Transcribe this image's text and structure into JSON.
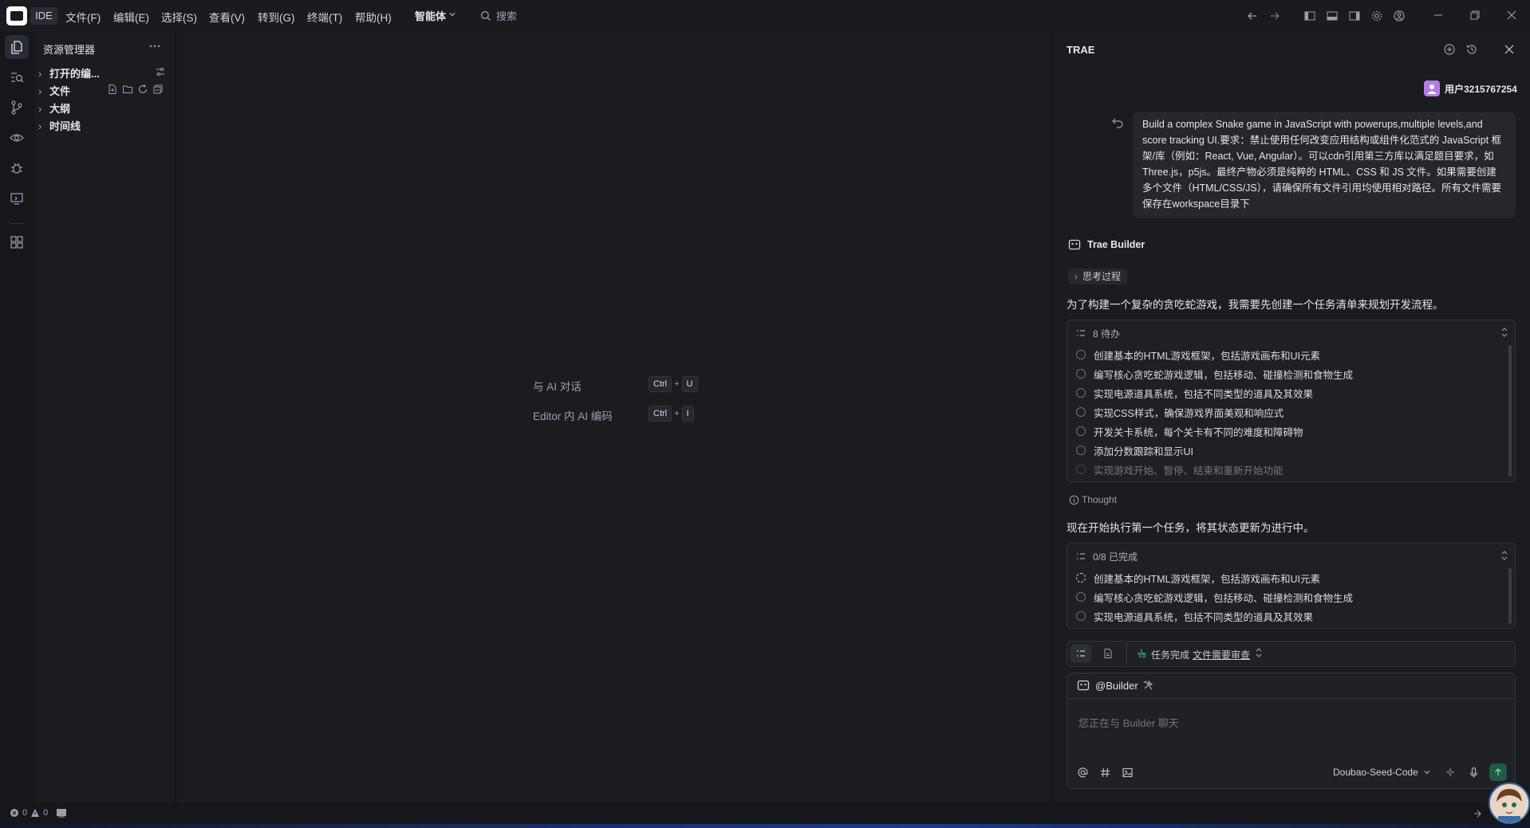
{
  "titlebar": {
    "ide_tag": "IDE",
    "menu": [
      "文件(F)",
      "编辑(E)",
      "选择(S)",
      "查看(V)",
      "转到(G)",
      "终端(T)",
      "帮助(H)"
    ],
    "mode": "智能体",
    "search_placeholder": "搜索"
  },
  "explorer": {
    "title": "资源管理器",
    "sections": [
      "打开的编...",
      "文件",
      "大纲",
      "时间线"
    ]
  },
  "editor": {
    "hints": [
      {
        "label": "与 AI 对话",
        "keys": [
          "Ctrl",
          "U"
        ]
      },
      {
        "label": "Editor 内 AI 编码",
        "keys": [
          "Ctrl",
          "I"
        ]
      }
    ],
    "plus": "+"
  },
  "chat": {
    "title": "TRAE",
    "user_name": "用户3215767254",
    "user_message": "Build a complex Snake game in JavaScript with powerups,multiple levels,and score tracking UI.要求：禁止使用任何改变应用结构或组件化范式的 JavaScript 框架/库（例如：React, Vue, Angular）。可以cdn引用第三方库以满足题目要求，如Three.js，p5js。最终产物必须是纯粹的 HTML、CSS 和 JS 文件。如果需要创建多个文件（HTML/CSS/JS），请确保所有文件引用均使用相对路径。所有文件需要保存在workspace目录下",
    "builder_name": "Trae Builder",
    "think_chip": "思考过程",
    "para1": "为了构建一个复杂的贪吃蛇游戏，我需要先创建一个任务清单来规划开发流程。",
    "todo_header": "8 待办",
    "todo_items": [
      "创建基本的HTML游戏框架，包括游戏画布和UI元素",
      "编写核心贪吃蛇游戏逻辑，包括移动、碰撞检测和食物生成",
      "实现电源道具系统，包括不同类型的道具及其效果",
      "实现CSS样式，确保游戏界面美观和响应式",
      "开发关卡系统，每个关卡有不同的难度和障碍物",
      "添加分数跟踪和显示UI",
      "实现游戏开始、暂停、结束和重新开始功能"
    ],
    "thought_label": "Thought",
    "para2": "现在开始执行第一个任务，将其状态更新为进行中。",
    "progress_header": "0/8 已完成",
    "progress_items": [
      "创建基本的HTML游戏框架，包括游戏画布和UI元素",
      "编写核心贪吃蛇游戏逻辑，包括移动、碰撞检测和食物生成",
      "实现电源道具系统，包括不同类型的道具及其效果"
    ],
    "status_text": "任务完成",
    "status_link": "文件需要审查",
    "agent_tag": "@Builder",
    "input_placeholder": "您正在与 Builder 聊天",
    "model": "Doubao-Seed-Code"
  },
  "statusbar": {
    "errors": "0",
    "warnings": "0"
  }
}
